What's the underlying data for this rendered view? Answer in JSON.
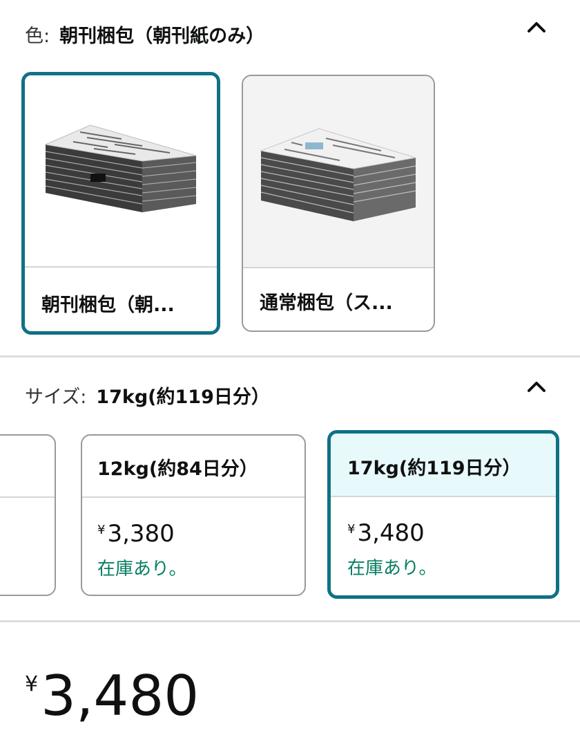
{
  "color_section": {
    "label": "色:",
    "selected_value": "朝刊梱包（朝刊紙のみ）",
    "options": [
      {
        "label": "朝刊梱包（朝..."
      },
      {
        "label": "通常梱包（ス..."
      }
    ]
  },
  "size_section": {
    "label": "サイズ:",
    "selected_value": "17kg(約119日分）",
    "options": [
      {
        "name": "12kg(約84日分）",
        "currency": "¥",
        "price": "3,380",
        "stock": "在庫あり。"
      },
      {
        "name": "17kg(約119日分）",
        "currency": "¥",
        "price": "3,480",
        "stock": "在庫あり。"
      }
    ]
  },
  "price": {
    "currency": "¥",
    "value": "3,480"
  },
  "colors": {
    "accent": "#0f7186",
    "in_stock": "#067d62",
    "selected_bg": "#e8f9fc"
  },
  "icons": {
    "collapse": "chevron-up-icon"
  }
}
